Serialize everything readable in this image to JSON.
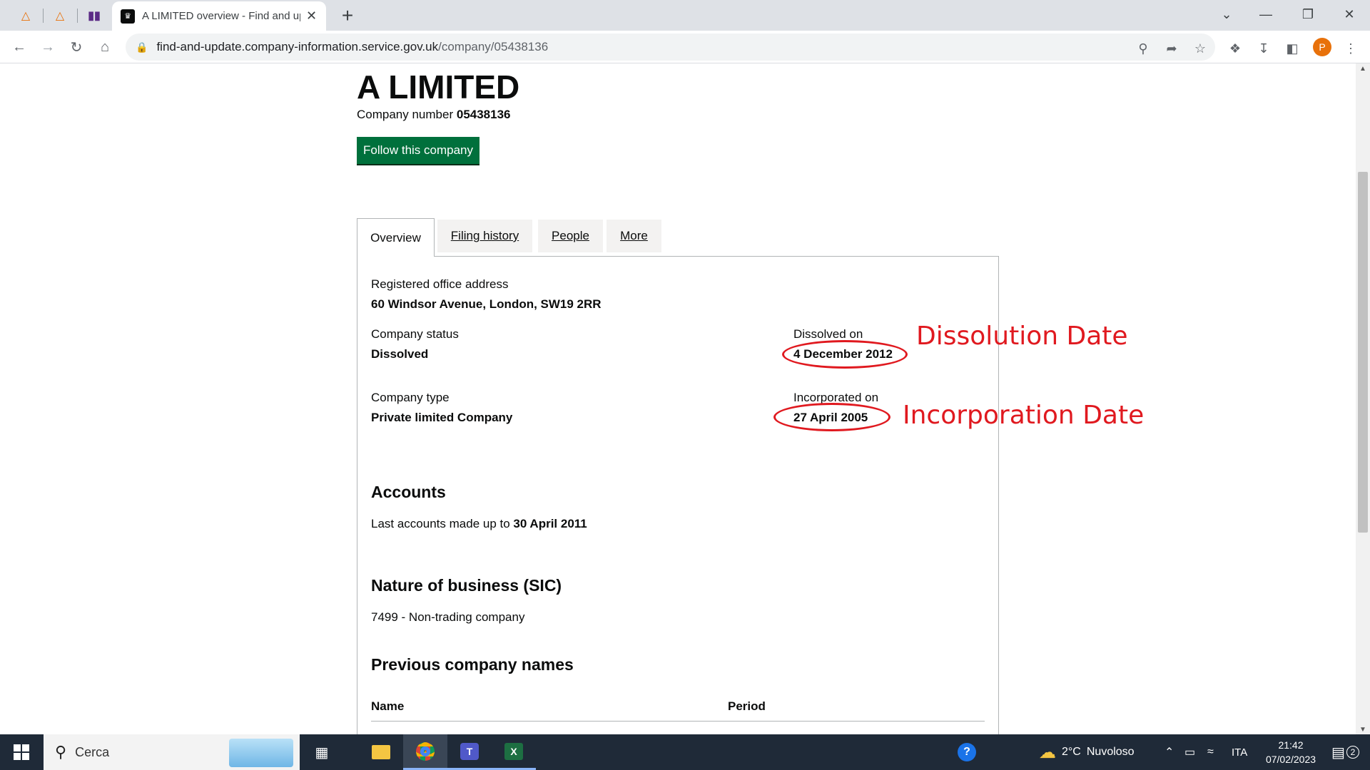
{
  "browser": {
    "tab_title": "A LIMITED overview - Find and update company information - GOV.UK",
    "url_host": "find-and-update.company-information.service.gov.uk",
    "url_path": "/company/05438136",
    "profile_initial": "P"
  },
  "company": {
    "name": "A LIMITED",
    "number_label": "Company number",
    "number": "05438136",
    "follow_label": "Follow this company"
  },
  "tabs": [
    "Overview",
    "Filing history",
    "People",
    "More"
  ],
  "overview": {
    "address_label": "Registered office address",
    "address": "60 Windsor Avenue, London, SW19 2RR",
    "status_label": "Company status",
    "status": "Dissolved",
    "dissolved_label": "Dissolved on",
    "dissolved_date": "4 December 2012",
    "type_label": "Company type",
    "type": "Private limited Company",
    "incorporated_label": "Incorporated on",
    "incorporated_date": "27 April 2005"
  },
  "accounts": {
    "heading": "Accounts",
    "text": "Last accounts made up to",
    "date": "30 April 2011"
  },
  "nature": {
    "heading": "Nature of business (SIC)",
    "sic": "7499 - Non-trading company"
  },
  "previous_names": {
    "heading": "Previous company names",
    "col_name": "Name",
    "col_period": "Period"
  },
  "annotations": {
    "dissolution": "Dissolution Date",
    "incorporation": "Incorporation Date",
    "color": "#e0191f"
  },
  "taskbar": {
    "search_placeholder": "Cerca",
    "weather_temp": "2°C",
    "weather_text": "Nuvoloso",
    "language": "ITA",
    "time": "21:42",
    "date": "07/02/2023",
    "notification_count": "2"
  },
  "colors": {
    "gov_green": "#00703c",
    "chrome_frame": "#dee1e6",
    "taskbar": "#1f2a38"
  }
}
